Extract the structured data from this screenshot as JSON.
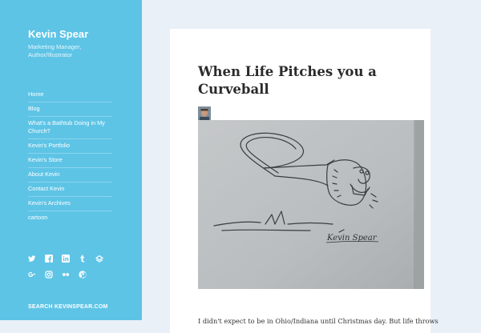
{
  "site": {
    "title": "Kevin Spear",
    "description": "Marketing Manager, Author/Illustrator"
  },
  "nav": {
    "items": [
      {
        "label": "Home"
      },
      {
        "label": "Blog"
      },
      {
        "label": "What's a Bathtub Doing in My Church?"
      },
      {
        "label": "Kevin's Portfolio"
      },
      {
        "label": "Kevin's Store"
      },
      {
        "label": "About Kevin"
      },
      {
        "label": "Contact Kevin"
      },
      {
        "label": "Kevin's Archives"
      },
      {
        "label": "cartoon"
      }
    ]
  },
  "social": {
    "icons": [
      "twitter-icon",
      "facebook-icon",
      "linkedin-icon",
      "tumblr-icon",
      "feed-icon",
      "google-plus-icon",
      "instagram-icon",
      "flickr-icon",
      "pinterest-icon"
    ]
  },
  "search": {
    "label": "SEARCH KEVINSPEAR.COM"
  },
  "post": {
    "title": "When Life Pitches you a Curveball",
    "signature": "Kevin Spear",
    "excerpt": "I didn't expect to be in Ohio/Indiana until Christmas day. But life throws"
  },
  "colors": {
    "sidebar": "#5ec4e6",
    "page_background": "#e9f0f7",
    "card": "#ffffff",
    "title_text": "#2b2b2b"
  }
}
